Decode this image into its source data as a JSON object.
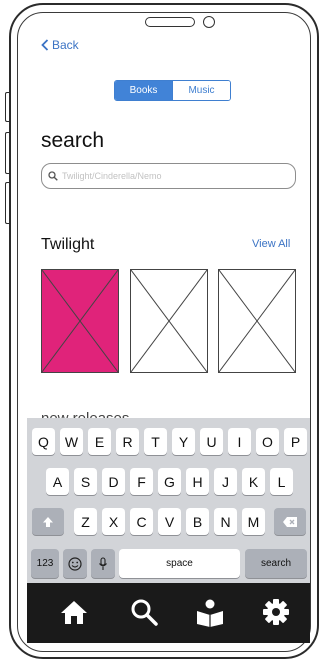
{
  "nav": {
    "back_label": "Back"
  },
  "segment": {
    "options": [
      "Books",
      "Music"
    ],
    "selected": "Books"
  },
  "search": {
    "title": "search",
    "placeholder": "Twilight/Cinderella/Nemo"
  },
  "section": {
    "title": "Twilight",
    "view_all": "View All",
    "next_title_partial": "new releases"
  },
  "keyboard": {
    "row1": [
      "Q",
      "W",
      "E",
      "R",
      "T",
      "Y",
      "U",
      "I",
      "O",
      "P"
    ],
    "row2": [
      "A",
      "S",
      "D",
      "F",
      "G",
      "H",
      "J",
      "K",
      "L"
    ],
    "row3": [
      "Z",
      "X",
      "C",
      "V",
      "B",
      "N",
      "M"
    ],
    "numbers_key": "123",
    "space_key": "space",
    "action_key": "search"
  },
  "tabbar": {
    "icons": [
      "home-icon",
      "search-icon",
      "reading-icon",
      "settings-icon"
    ]
  },
  "colors": {
    "accent": "#4183d7",
    "link": "#3b73c4",
    "featured_cover": "#e0237a",
    "tabbar_bg": "#1a1a1a",
    "keyboard_bg": "#d2d4d8"
  }
}
